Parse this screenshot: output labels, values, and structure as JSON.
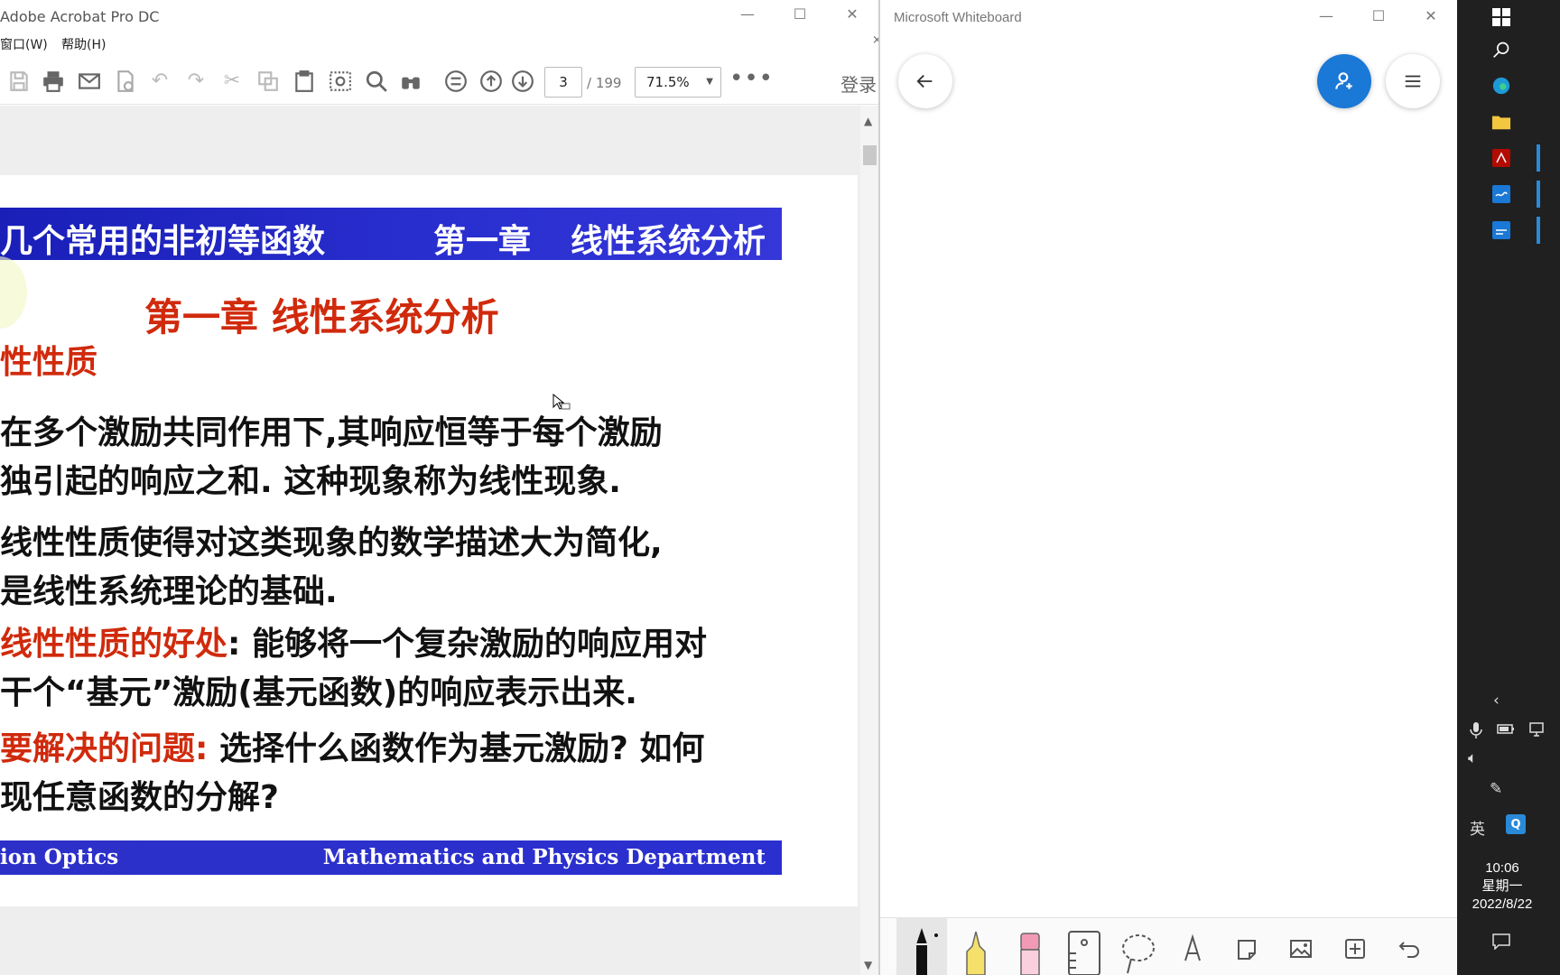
{
  "acrobat": {
    "title": "Adobe Acrobat Pro DC",
    "menu": {
      "window": "窗口(W)",
      "help": "帮助(H)"
    },
    "page_current": "3",
    "page_total": "/ 199",
    "zoom": "71.5%",
    "login": "登录",
    "slide": {
      "header_left": "几个常用的非初等函数",
      "header_chapter": "第一章",
      "header_right": "线性系统分析",
      "chapter_title": "第一章 线性系统分析",
      "section": "性性质",
      "lines": [
        "在多个激励共同作用下,其响应恒等于每个激励",
        "独引起的响应之和. 这种现象称为线性现象.",
        "线性性质使得对这类现象的数学描述大为简化,",
        "是线性系统理论的基础."
      ],
      "benefit_label": "线性性质的好处",
      "benefit_text": ": 能够将一个复杂激励的响应用对",
      "benefit_line2": "干个“基元”激励(基元函数)的响应表示出来.",
      "problem_label": "要解决的问题:",
      "problem_text": " 选择什么函数作为基元激励? 如何",
      "problem_line2": "现任意函数的分解?",
      "footer_left": "ion Optics",
      "footer_right": "Mathematics and Physics Department"
    }
  },
  "whiteboard": {
    "title": "Microsoft Whiteboard"
  },
  "taskbar": {
    "ime": "英",
    "time": "10:06",
    "weekday": "星期一",
    "date": "2022/8/22"
  }
}
